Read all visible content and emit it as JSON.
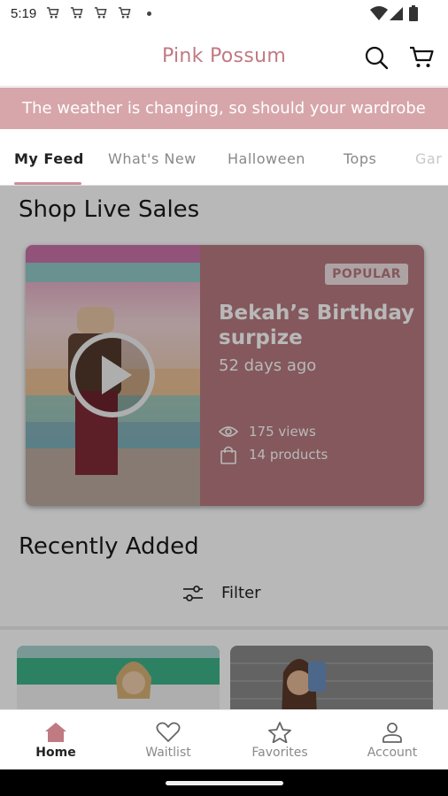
{
  "status_bar": {
    "time": "5:19",
    "notification_icons": [
      "shopping-cart-icon",
      "shopping-cart-icon",
      "shopping-cart-icon",
      "shopping-cart-icon"
    ],
    "system_icons": [
      "wifi-icon",
      "signal-icon",
      "battery-icon"
    ]
  },
  "app_bar": {
    "title": "Pink Possum",
    "brand_color": "#c07a82"
  },
  "banner": {
    "text": "The weather is changing, so should your wardrobe",
    "background": "#d7a6ab"
  },
  "tabs": [
    {
      "label": "My Feed",
      "active": true
    },
    {
      "label": "What's New",
      "active": false
    },
    {
      "label": "Halloween",
      "active": false
    },
    {
      "label": "Tops",
      "active": false
    },
    {
      "label": "Gar",
      "active": false
    }
  ],
  "live_sales": {
    "section_title": "Shop Live Sales",
    "card": {
      "badge": "POPULAR",
      "title": "Bekah’s Birthday surpize",
      "age": "52 days ago",
      "views": "175 views",
      "products": "14 products",
      "accent": "#b87a80"
    }
  },
  "recently_added": {
    "section_title": "Recently Added",
    "filter_label": "Filter"
  },
  "bottom_nav": [
    {
      "label": "Home",
      "icon": "home-icon",
      "active": true
    },
    {
      "label": "Waitlist",
      "icon": "heart-icon",
      "active": false
    },
    {
      "label": "Favorites",
      "icon": "star-icon",
      "active": false
    },
    {
      "label": "Account",
      "icon": "person-icon",
      "active": false
    }
  ]
}
